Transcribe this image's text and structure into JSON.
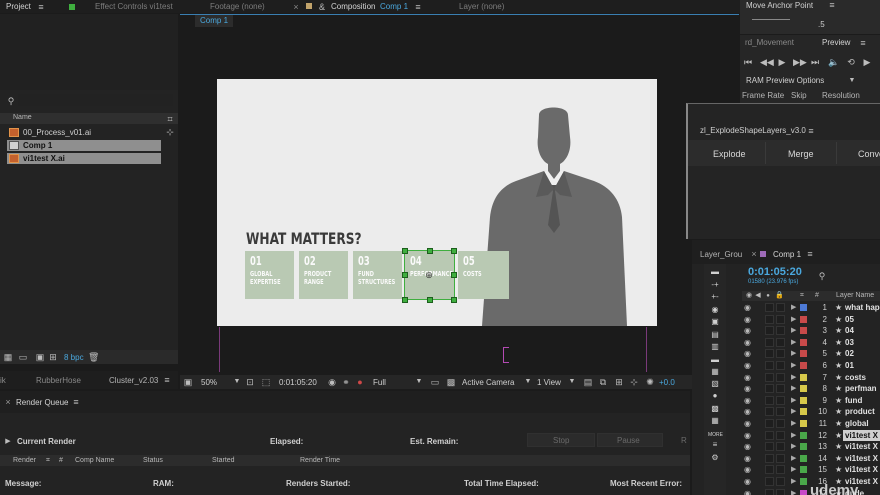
{
  "tabs": {
    "project": "Project",
    "effect_controls": "Effect Controls vi1test",
    "footage": "Footage (none)",
    "composition": "Composition",
    "composition_name": "Comp 1",
    "layer": "Layer (none)",
    "move_anchor": "Move Anchor Point",
    "rd_movement": "rd_Movement",
    "preview": "Preview",
    "rubberhose": "RubberHose",
    "cluster": "Cluster_v2.03",
    "render_queue": "Render Queue",
    "partial_left": "ik",
    "layer_group": "Layer_Grou",
    "timeline_comp": "Comp 1"
  },
  "project": {
    "col_name": "Name",
    "items": [
      {
        "name": "00_Process_v01.ai",
        "selected": false
      },
      {
        "name": "Comp 1",
        "selected": true
      },
      {
        "name": "vi1test X.ai",
        "selected": true
      }
    ],
    "bpc": "8 bpc"
  },
  "anchor": {
    "value": ".5"
  },
  "preview": {
    "ram_options": "RAM Preview Options",
    "frame_rate": "Frame Rate",
    "skip": "Skip",
    "resolution": "Resolution"
  },
  "viewer": {
    "comp_tab": "Comp 1",
    "headline": "WHAT MATTERS?",
    "cards": [
      {
        "num": "01",
        "label": "GLOBAL EXPERTISE"
      },
      {
        "num": "02",
        "label": "PRODUCT RANGE"
      },
      {
        "num": "03",
        "label": "FUND STRUCTURES"
      },
      {
        "num": "04",
        "label": "PERFORMANCE"
      },
      {
        "num": "05",
        "label": "COSTS"
      }
    ],
    "zoom": "50%",
    "timecode": "0:01:05:20",
    "quality": "Full",
    "camera": "Active Camera",
    "views": "1 View",
    "exposure": "+0.0"
  },
  "explode": {
    "title": "zl_ExplodeShapeLayers_v3.0",
    "buttons": [
      "Explode",
      "Merge",
      "Conve"
    ]
  },
  "timeline": {
    "timecode": "0:01:05:20",
    "frames": "01580 (23.976 fps)",
    "col_num": "#",
    "col_layer": "Layer Name",
    "layers": [
      {
        "idx": "1",
        "name": "what hap",
        "color": "#4d7ad6",
        "highlight": false
      },
      {
        "idx": "2",
        "name": "05",
        "color": "#c84a4a",
        "highlight": false
      },
      {
        "idx": "3",
        "name": "04",
        "color": "#c84a4a",
        "highlight": false
      },
      {
        "idx": "4",
        "name": "03",
        "color": "#c84a4a",
        "highlight": false
      },
      {
        "idx": "5",
        "name": "02",
        "color": "#c84a4a",
        "highlight": false
      },
      {
        "idx": "6",
        "name": "01",
        "color": "#c84a4a",
        "highlight": false
      },
      {
        "idx": "7",
        "name": "costs",
        "color": "#d6c84a",
        "highlight": false
      },
      {
        "idx": "8",
        "name": "perfman",
        "color": "#d6c84a",
        "highlight": false
      },
      {
        "idx": "9",
        "name": "fund",
        "color": "#d6c84a",
        "highlight": false
      },
      {
        "idx": "10",
        "name": "product",
        "color": "#d6c84a",
        "highlight": false
      },
      {
        "idx": "11",
        "name": "global",
        "color": "#d6c84a",
        "highlight": false
      },
      {
        "idx": "12",
        "name": "vi1test X",
        "color": "#4aa84a",
        "highlight": true
      },
      {
        "idx": "13",
        "name": "vi1test X",
        "color": "#4aa84a",
        "highlight": false
      },
      {
        "idx": "14",
        "name": "vi1test X",
        "color": "#4aa84a",
        "highlight": false
      },
      {
        "idx": "15",
        "name": "vi1test X",
        "color": "#4aa84a",
        "highlight": false
      },
      {
        "idx": "16",
        "name": "vi1test X",
        "color": "#4aa84a",
        "highlight": false
      },
      {
        "idx": "17",
        "name": "dude",
        "color": "#c84ac8",
        "highlight": false
      }
    ],
    "more": "MORE"
  },
  "render": {
    "current_render": "Current Render",
    "elapsed": "Elapsed:",
    "est_remain": "Est. Remain:",
    "stop": "Stop",
    "pause": "Pause",
    "r": "R",
    "col_render": "Render",
    "col_hash": "#",
    "col_comp": "Comp Name",
    "col_status": "Status",
    "col_started": "Started",
    "col_time": "Render Time",
    "message": "Message:",
    "ram": "RAM:",
    "renders_started": "Renders Started:",
    "total_time": "Total Time Elapsed:",
    "recent_error": "Most Recent Error:"
  },
  "watermark": "udemy"
}
